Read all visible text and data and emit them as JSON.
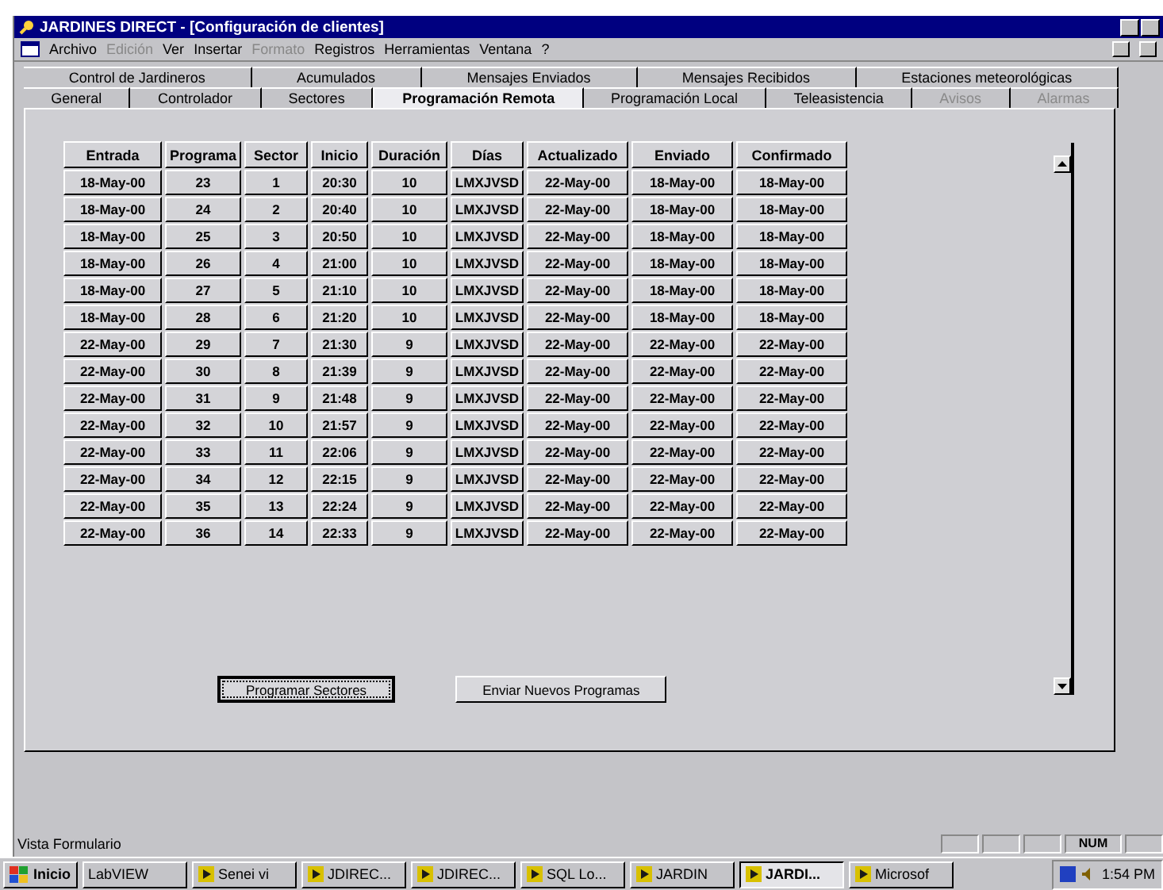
{
  "window": {
    "title": "JARDINES DIRECT - [Configuración de clientes]"
  },
  "menu": [
    {
      "label": "Archivo",
      "disabled": false
    },
    {
      "label": "Edición",
      "disabled": true
    },
    {
      "label": "Ver",
      "disabled": false
    },
    {
      "label": "Insertar",
      "disabled": false
    },
    {
      "label": "Formato",
      "disabled": true
    },
    {
      "label": "Registros",
      "disabled": false
    },
    {
      "label": "Herramientas",
      "disabled": false
    },
    {
      "label": "Ventana",
      "disabled": false
    },
    {
      "label": "?",
      "disabled": false
    }
  ],
  "tab_rows": [
    [
      {
        "label": "Control de Jardineros",
        "selected": false,
        "disabled": false
      },
      {
        "label": "Acumulados",
        "selected": false,
        "disabled": false
      },
      {
        "label": "Mensajes Enviados",
        "selected": false,
        "disabled": false
      },
      {
        "label": "Mensajes Recibidos",
        "selected": false,
        "disabled": false
      },
      {
        "label": "Estaciones meteorológicas",
        "selected": false,
        "disabled": false
      }
    ],
    [
      {
        "label": "General",
        "selected": false,
        "disabled": false
      },
      {
        "label": "Controlador",
        "selected": false,
        "disabled": false
      },
      {
        "label": "Sectores",
        "selected": false,
        "disabled": false
      },
      {
        "label": "Programación Remota",
        "selected": true,
        "disabled": false
      },
      {
        "label": "Programación Local",
        "selected": false,
        "disabled": false
      },
      {
        "label": "Teleasistencia",
        "selected": false,
        "disabled": false
      },
      {
        "label": "Avisos",
        "selected": false,
        "disabled": true
      },
      {
        "label": "Alarmas",
        "selected": false,
        "disabled": true
      }
    ]
  ],
  "table": {
    "columns": [
      "Entrada",
      "Programa",
      "Sector",
      "Inicio",
      "Duración",
      "Días",
      "Actualizado",
      "Enviado",
      "Confirmado"
    ],
    "rows": [
      [
        "18-May-00",
        "23",
        "1",
        "20:30",
        "10",
        "LMXJVSD",
        "22-May-00",
        "18-May-00",
        "18-May-00"
      ],
      [
        "18-May-00",
        "24",
        "2",
        "20:40",
        "10",
        "LMXJVSD",
        "22-May-00",
        "18-May-00",
        "18-May-00"
      ],
      [
        "18-May-00",
        "25",
        "3",
        "20:50",
        "10",
        "LMXJVSD",
        "22-May-00",
        "18-May-00",
        "18-May-00"
      ],
      [
        "18-May-00",
        "26",
        "4",
        "21:00",
        "10",
        "LMXJVSD",
        "22-May-00",
        "18-May-00",
        "18-May-00"
      ],
      [
        "18-May-00",
        "27",
        "5",
        "21:10",
        "10",
        "LMXJVSD",
        "22-May-00",
        "18-May-00",
        "18-May-00"
      ],
      [
        "18-May-00",
        "28",
        "6",
        "21:20",
        "10",
        "LMXJVSD",
        "22-May-00",
        "18-May-00",
        "18-May-00"
      ],
      [
        "22-May-00",
        "29",
        "7",
        "21:30",
        "9",
        "LMXJVSD",
        "22-May-00",
        "22-May-00",
        "22-May-00"
      ],
      [
        "22-May-00",
        "30",
        "8",
        "21:39",
        "9",
        "LMXJVSD",
        "22-May-00",
        "22-May-00",
        "22-May-00"
      ],
      [
        "22-May-00",
        "31",
        "9",
        "21:48",
        "9",
        "LMXJVSD",
        "22-May-00",
        "22-May-00",
        "22-May-00"
      ],
      [
        "22-May-00",
        "32",
        "10",
        "21:57",
        "9",
        "LMXJVSD",
        "22-May-00",
        "22-May-00",
        "22-May-00"
      ],
      [
        "22-May-00",
        "33",
        "11",
        "22:06",
        "9",
        "LMXJVSD",
        "22-May-00",
        "22-May-00",
        "22-May-00"
      ],
      [
        "22-May-00",
        "34",
        "12",
        "22:15",
        "9",
        "LMXJVSD",
        "22-May-00",
        "22-May-00",
        "22-May-00"
      ],
      [
        "22-May-00",
        "35",
        "13",
        "22:24",
        "9",
        "LMXJVSD",
        "22-May-00",
        "22-May-00",
        "22-May-00"
      ],
      [
        "22-May-00",
        "36",
        "14",
        "22:33",
        "9",
        "LMXJVSD",
        "22-May-00",
        "22-May-00",
        "22-May-00"
      ]
    ]
  },
  "buttons": [
    {
      "label": "Programar Sectores",
      "focused": true
    },
    {
      "label": "Enviar Nuevos Programas",
      "focused": false
    }
  ],
  "status_bar": {
    "text": "Vista Formulario",
    "num": "NUM"
  },
  "taskbar": {
    "start": "Inicio",
    "items": [
      {
        "label": "LabVIEW",
        "selected": false
      },
      {
        "label": "Senei vi",
        "selected": false
      },
      {
        "label": "JDIREC...",
        "selected": false
      },
      {
        "label": "JDIREC...",
        "selected": false
      },
      {
        "label": "SQL Lo...",
        "selected": false
      },
      {
        "label": "JARDIN",
        "selected": false
      },
      {
        "label": "JARDI...",
        "selected": true
      },
      {
        "label": "Microsof",
        "selected": false
      }
    ],
    "clock": "1:54 PM"
  }
}
